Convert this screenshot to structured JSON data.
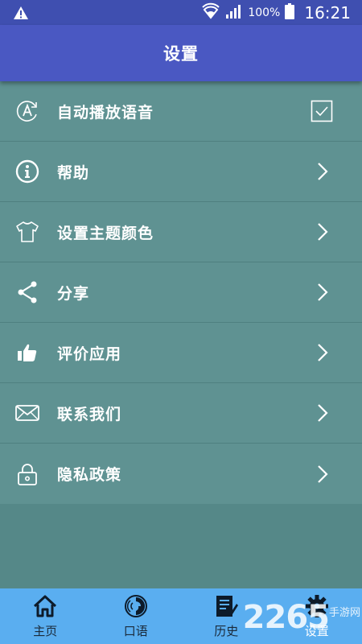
{
  "status_bar": {
    "battery_percent": "100%",
    "time": "16:21"
  },
  "app_bar": {
    "title": "设置"
  },
  "settings": {
    "items": [
      {
        "label": "自动播放语音",
        "icon": "auto-play-icon",
        "trailing": "checkbox",
        "checked": true
      },
      {
        "label": "帮助",
        "icon": "info-icon",
        "trailing": "chevron"
      },
      {
        "label": "设置主题颜色",
        "icon": "tshirt-icon",
        "trailing": "chevron"
      },
      {
        "label": "分享",
        "icon": "share-icon",
        "trailing": "chevron"
      },
      {
        "label": "评价应用",
        "icon": "thumbs-up-icon",
        "trailing": "chevron"
      },
      {
        "label": "联系我们",
        "icon": "mail-icon",
        "trailing": "chevron"
      },
      {
        "label": "隐私政策",
        "icon": "lock-icon",
        "trailing": "chevron"
      }
    ]
  },
  "bottom_nav": {
    "items": [
      {
        "label": "主页",
        "icon": "home-icon",
        "active": false
      },
      {
        "label": "口语",
        "icon": "speech-icon",
        "active": false
      },
      {
        "label": "历史",
        "icon": "history-icon",
        "active": false
      },
      {
        "label": "设置",
        "icon": "gear-icon",
        "active": true
      }
    ]
  },
  "watermark": {
    "number": "2265",
    "text": "手游网"
  },
  "colors": {
    "status_bar": "#3f4fb0",
    "app_bar": "#4a58c2",
    "list_bg": "#5f9292",
    "page_bg": "#558888",
    "bottom_nav": "#5aaef0"
  }
}
